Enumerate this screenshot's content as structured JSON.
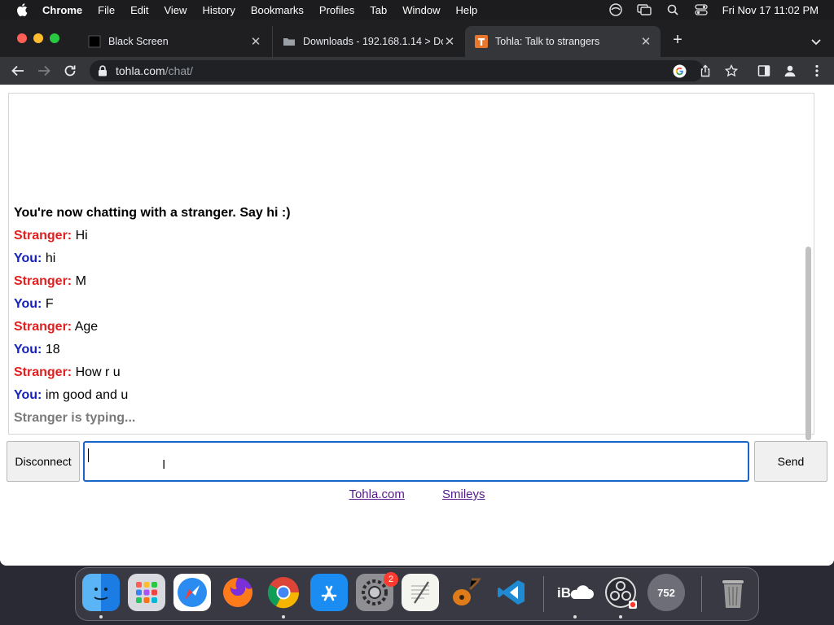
{
  "menubar": {
    "app_name": "Chrome",
    "items": [
      "File",
      "Edit",
      "View",
      "History",
      "Bookmarks",
      "Profiles",
      "Tab",
      "Window",
      "Help"
    ],
    "clock": "Fri Nov 17  11:02 PM"
  },
  "browser": {
    "tabs": [
      {
        "title": "Black Screen",
        "active": false
      },
      {
        "title": "Downloads - 192.168.1.14 > Do",
        "active": false
      },
      {
        "title": "Tohla: Talk to strangers",
        "active": true
      }
    ],
    "url_host": "tohla.com",
    "url_path": "/chat/"
  },
  "chat": {
    "system_message": "You're now chatting with a stranger. Say hi :)",
    "stranger_label": "Stranger:",
    "you_label": "You:",
    "messages": [
      {
        "from": "stranger",
        "text": "Hi"
      },
      {
        "from": "you",
        "text": "hi"
      },
      {
        "from": "stranger",
        "text": "M"
      },
      {
        "from": "you",
        "text": "F"
      },
      {
        "from": "stranger",
        "text": "Age"
      },
      {
        "from": "you",
        "text": "18"
      },
      {
        "from": "stranger",
        "text": "How r u"
      },
      {
        "from": "you",
        "text": "im good and u"
      }
    ],
    "typing_status": "Stranger is typing...",
    "input_value": "",
    "disconnect_label": "Disconnect",
    "send_label": "Send"
  },
  "footer_links": [
    "Tohla.com",
    "Smileys"
  ],
  "dock": {
    "apps": [
      "Finder",
      "Launchpad",
      "Safari",
      "Firefox",
      "Chrome",
      "App Store",
      "System Preferences",
      "TextEdit",
      "GarageBand",
      "Visual Studio Code",
      "iCloud",
      "OBS",
      "752",
      "Trash"
    ],
    "system_preferences_badge": "2",
    "count_app_label": "752"
  },
  "colors": {
    "stranger": "#e02020",
    "you": "#1520c0",
    "input_focus": "#1a66c8",
    "link": "#551a8b"
  }
}
